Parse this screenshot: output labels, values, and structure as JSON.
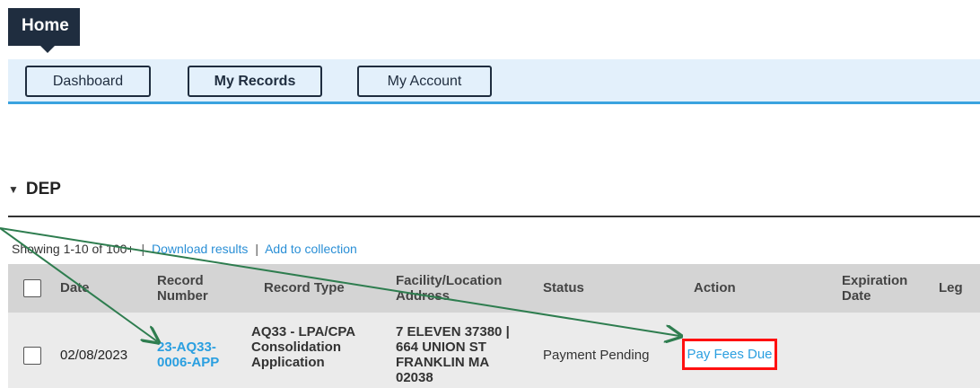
{
  "home_tab": {
    "label": "Home"
  },
  "nav": {
    "dashboard": "Dashboard",
    "my_records": "My Records",
    "my_account": "My Account"
  },
  "section": {
    "title": "DEP"
  },
  "toolbar": {
    "showing": "Showing 1-10 of 100+",
    "sep1": "|",
    "download": "Download results",
    "sep2": "|",
    "add": "Add to collection"
  },
  "table": {
    "headers": {
      "date": "Date",
      "record_number": "Record Number",
      "record_type": "Record Type",
      "address": "Facility/Location Address",
      "status": "Status",
      "action": "Action",
      "expiration": "Expiration Date",
      "leg": "Leg"
    },
    "row": {
      "date": "02/08/2023",
      "record_number": "23-AQ33-0006-APP",
      "record_type": "AQ33 - LPA/CPA Consolidation Application",
      "address": "7 ELEVEN 37380 | 664 UNION ST FRANKLIN MA 02038",
      "status": "Payment Pending",
      "action": "Pay Fees Due"
    }
  },
  "colors": {
    "nav_bg": "#e3f0fb",
    "accent": "#3aa3df",
    "link": "#2a9fe0",
    "highlight": "#ff1010",
    "arrow": "#2e7d4f"
  }
}
